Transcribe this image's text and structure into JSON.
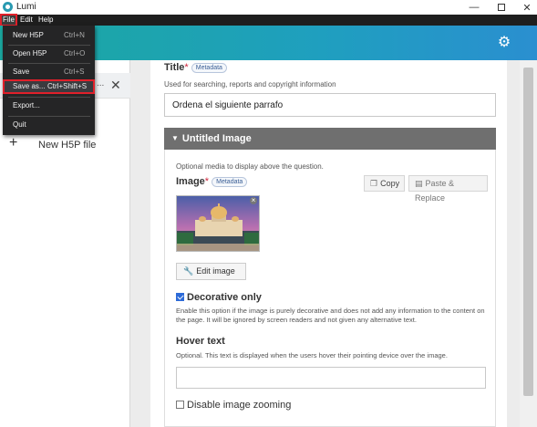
{
  "window": {
    "title": "Lumi",
    "minimize": "—",
    "close": "✕"
  },
  "menubar": {
    "file": "File",
    "edit": "Edit",
    "help": "Help"
  },
  "file_menu": {
    "items": [
      {
        "label": "New H5P",
        "accel": "Ctrl+N"
      },
      {
        "label": "Open H5P",
        "accel": "Ctrl+O"
      },
      {
        "label": "Save",
        "accel": "Ctrl+S"
      },
      {
        "label": "Save as...",
        "accel": "Ctrl+Shift+S"
      },
      {
        "label": "Export...",
        "accel": ""
      },
      {
        "label": "Quit",
        "accel": ""
      }
    ]
  },
  "sidebar": {
    "ellipsis": "...",
    "close": "✕",
    "new_file": "New H5P file"
  },
  "form": {
    "title_label": "Title",
    "required_mark": "*",
    "metadata_label": "Metadata",
    "title_desc": "Used for searching, reports and copyright information",
    "title_value": "Ordena el siguiente parrafo",
    "group_title": "Untitled Image",
    "media_desc": "Optional media to display above the question.",
    "image_label": "Image",
    "copy_label": "Copy",
    "paste_label": "Paste & Replace",
    "edit_image_label": "Edit image",
    "decorative_label": "Decorative only",
    "decorative_checked": true,
    "decorative_desc": "Enable this option if the image is purely decorative and does not add any information to the content on the page. It will be ignored by screen readers and not given any alternative text.",
    "hover_label": "Hover text",
    "hover_desc": "Optional. This text is displayed when the users hover their pointing device over the image.",
    "hover_value": "",
    "zoom_label": "Disable image zooming",
    "zoom_checked": false
  },
  "colors": {
    "header_start": "#1ba8a0",
    "header_end": "#2a8fd0",
    "highlight": "#e0202a",
    "group_header": "#6f6f6f"
  }
}
